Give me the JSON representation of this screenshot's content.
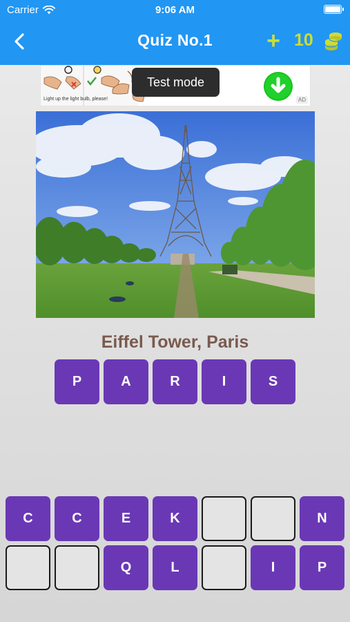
{
  "status_bar": {
    "carrier": "Carrier",
    "time": "9:06 AM"
  },
  "nav": {
    "title": "Quiz No.1",
    "add_label": "+",
    "coins": "10"
  },
  "ad": {
    "caption": "Light up the light bulb, please!",
    "tag": "AD"
  },
  "toast": "Test mode",
  "question": {
    "caption": "Eiffel Tower, Paris"
  },
  "answer_slots": [
    "P",
    "A",
    "R",
    "I",
    "S"
  ],
  "letter_pool": {
    "row1": [
      "C",
      "C",
      "E",
      "K",
      "",
      "",
      "N"
    ],
    "row2": [
      "",
      "",
      "Q",
      "L",
      "",
      "I",
      "P"
    ]
  },
  "colors": {
    "header": "#2196f3",
    "tile": "#6a38b5",
    "accent": "#cddc39",
    "caption": "#7a5a4e"
  },
  "icons": [
    "wifi-icon",
    "battery-icon",
    "back-arrow-icon",
    "plus-icon",
    "coin-stack-icon",
    "download-icon"
  ]
}
